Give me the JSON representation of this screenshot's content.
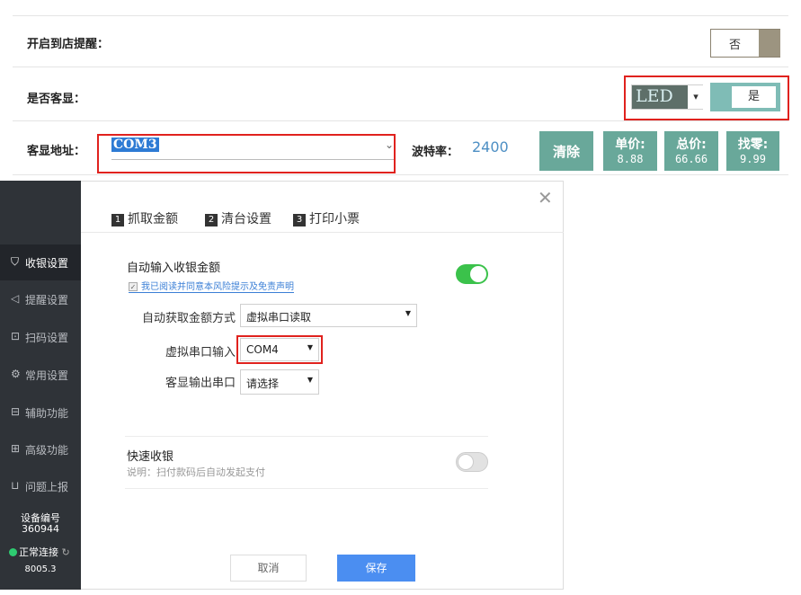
{
  "top": {
    "row1_label": "开启到店提醒：",
    "arrival_switch": "否",
    "row2_label": "是否客显：",
    "display_type": "LED",
    "customer_display_switch": "是",
    "row3_label": "客显地址：",
    "com_port": "COM3",
    "baud_label": "波特率：",
    "baud_value": "2400",
    "buttons": {
      "clear": "清除",
      "unit_price_label": "单价:",
      "unit_price_value": "8.88",
      "total_label": "总价:",
      "total_value": "66.66",
      "change_label": "找零:",
      "change_value": "9.99"
    }
  },
  "sidebar": {
    "items": [
      {
        "icon": "cash-register-icon",
        "glyph": "⛉",
        "label": "收银设置"
      },
      {
        "icon": "speaker-icon",
        "glyph": "◁",
        "label": "提醒设置"
      },
      {
        "icon": "scan-icon",
        "glyph": "⊡",
        "label": "扫码设置"
      },
      {
        "icon": "gear-icon",
        "glyph": "⚙",
        "label": "常用设置"
      },
      {
        "icon": "toolbox-icon",
        "glyph": "⊟",
        "label": "辅助功能"
      },
      {
        "icon": "grid-icon",
        "glyph": "⊞",
        "label": "高级功能"
      },
      {
        "icon": "report-icon",
        "glyph": "⊔",
        "label": "问题上报"
      }
    ],
    "device_label": "设备编号",
    "device_id": "360944",
    "connection_status": "正常连接",
    "version": "8005.3"
  },
  "dialog": {
    "tabs": [
      {
        "num": "1",
        "label": "抓取金额"
      },
      {
        "num": "2",
        "label": "清台设置"
      },
      {
        "num": "3",
        "label": "打印小票"
      }
    ],
    "auto_input_title": "自动输入收银金额",
    "agreement": "我已阅读并同意本风险提示及免责声明",
    "fetch_method_label": "自动获取金额方式",
    "fetch_method_value": "虚拟串口读取",
    "virtual_port_label": "虚拟串口输入",
    "virtual_port_value": "COM4",
    "display_port_label": "客显输出串口",
    "display_port_value": "请选择",
    "fast_title": "快速收银",
    "fast_note": "说明：扫付款码后自动发起支付",
    "cancel": "取消",
    "save": "保存"
  },
  "colors": {
    "accent_teal": "#69a89a",
    "highlight_red": "#e0221e",
    "toggle_on": "#3bc24b",
    "primary_blue": "#4b8ef1",
    "sidebar_bg": "#2f3338"
  }
}
